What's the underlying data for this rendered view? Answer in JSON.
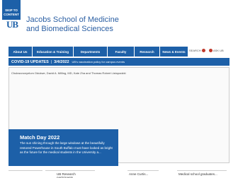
{
  "header": {
    "skip_label_1": "SKIP TO",
    "skip_label_2": "CONTENT",
    "logo_text": "UB",
    "school_line_1": "Jacobs School of Medicine",
    "school_line_2": "and Biomedical Sciences"
  },
  "nav": {
    "items": [
      "About Us",
      "Education & Training",
      "Departments",
      "Faculty",
      "Research",
      "News & Events"
    ],
    "search_label": "SEARCH",
    "askub_label": "ASK UB"
  },
  "alert": {
    "title": "COVID-19 UPDATES",
    "date": "3/4/2022",
    "message": "UB's vaccination policy for campus events"
  },
  "hero": {
    "caption": "Chukwunonyelum Odukwe, David A. Milling, MD, Kate Zha and Thomas Robert Listopadzki"
  },
  "feature": {
    "title": "Match Day 2022",
    "text": "The sun shining through the large windows at the beautifully restored Powerhouse in South Buffalo must have looked as bright as the future for the medical students in the University a..."
  },
  "tiles": {
    "t1": "",
    "t2": "",
    "t3": "UB Research participants...",
    "t4": "Anne Curtis...",
    "t5": "Medical school graduates..."
  }
}
